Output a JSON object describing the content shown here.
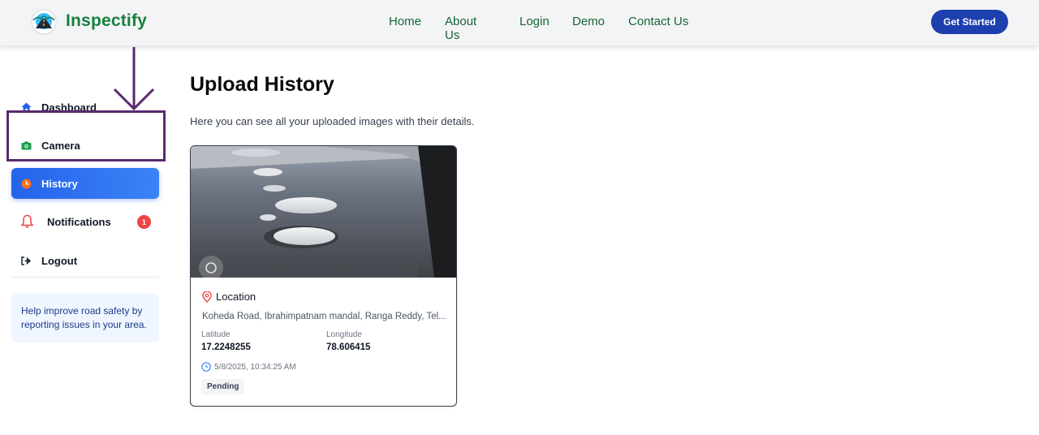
{
  "header": {
    "brand": "Inspectify",
    "nav": [
      "Home",
      "About Us",
      "Login",
      "Demo",
      "Contact Us"
    ],
    "cta_label": "Get Started"
  },
  "sidebar": {
    "items": [
      {
        "label": "Dashboard",
        "icon": "home-icon"
      },
      {
        "label": "Camera",
        "icon": "camera-icon"
      },
      {
        "label": "History",
        "icon": "clock-icon",
        "active": true
      },
      {
        "label": "Notifications",
        "icon": "bell-icon",
        "badge": "1"
      },
      {
        "label": "Logout",
        "icon": "logout-icon"
      }
    ],
    "help_text": "Help improve road safety by reporting issues in your area."
  },
  "main": {
    "title": "Upload History",
    "subtitle": "Here you can see all your uploaded images with their details.",
    "uploads": [
      {
        "location_label": "Location",
        "address": "Koheda Road, Ibrahimpatnam mandal, Ranga Reddy, Tel...",
        "latitude_label": "Latitude",
        "latitude": "17.2248255",
        "longitude_label": "Longitude",
        "longitude": "78.606415",
        "timestamp": "5/8/2025, 10:34:25 AM",
        "status": "Pending"
      }
    ]
  },
  "colors": {
    "brand_green": "#15803d",
    "nav_green": "#166534",
    "cta_blue": "#1e40af",
    "active_blue": "#2563eb",
    "badge_red": "#ef4444",
    "annotation_purple": "#5b2a6e"
  }
}
